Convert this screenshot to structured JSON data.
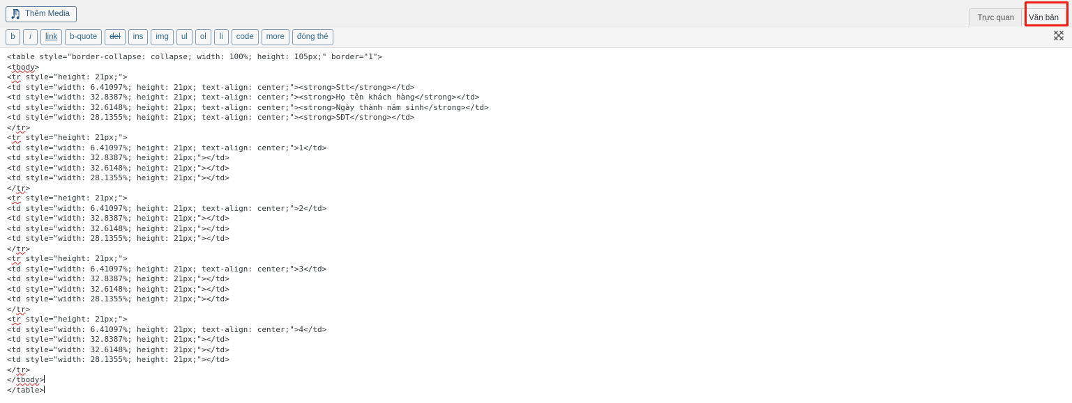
{
  "media_bar": {
    "add_media_label": "Thêm Media",
    "add_media_icon": "admin-media-icon"
  },
  "editor_tabs": {
    "visual_label": "Trực quan",
    "text_label": "Văn bản",
    "active": "Văn bản",
    "highlight_color": "#ee1b11"
  },
  "quicktags": {
    "buttons": [
      {
        "label": "b",
        "name": "quicktag-bold"
      },
      {
        "label": "i",
        "name": "quicktag-italic"
      },
      {
        "label": "link",
        "name": "quicktag-link"
      },
      {
        "label": "b-quote",
        "name": "quicktag-blockquote"
      },
      {
        "label": "del",
        "name": "quicktag-del"
      },
      {
        "label": "ins",
        "name": "quicktag-ins"
      },
      {
        "label": "img",
        "name": "quicktag-img"
      },
      {
        "label": "ul",
        "name": "quicktag-ul"
      },
      {
        "label": "ol",
        "name": "quicktag-ol"
      },
      {
        "label": "li",
        "name": "quicktag-li"
      },
      {
        "label": "code",
        "name": "quicktag-code"
      },
      {
        "label": "more",
        "name": "quicktag-more"
      },
      {
        "label": "đóng thẻ",
        "name": "quicktag-close-tags"
      }
    ],
    "fullscreen_icon": "fullscreen-icon"
  },
  "code_editor": {
    "lines": [
      "<table style=\"border-collapse: collapse; width: 100%; height: 105px;\" border=\"1\">",
      "<tbody>",
      "<tr style=\"height: 21px;\">",
      "<td style=\"width: 6.41097%; height: 21px; text-align: center;\"><strong>Stt</strong></td>",
      "<td style=\"width: 32.8387%; height: 21px; text-align: center;\"><strong>Họ tên khách hàng</strong></td>",
      "<td style=\"width: 32.6148%; height: 21px; text-align: center;\"><strong>Ngày thành năm sinh</strong></td>",
      "<td style=\"width: 28.1355%; height: 21px; text-align: center;\"><strong>SĐT</strong></td>",
      "</tr>",
      "<tr style=\"height: 21px;\">",
      "<td style=\"width: 6.41097%; height: 21px; text-align: center;\">1</td>",
      "<td style=\"width: 32.8387%; height: 21px;\"></td>",
      "<td style=\"width: 32.6148%; height: 21px;\"></td>",
      "<td style=\"width: 28.1355%; height: 21px;\"></td>",
      "</tr>",
      "<tr style=\"height: 21px;\">",
      "<td style=\"width: 6.41097%; height: 21px; text-align: center;\">2</td>",
      "<td style=\"width: 32.8387%; height: 21px;\"></td>",
      "<td style=\"width: 32.6148%; height: 21px;\"></td>",
      "<td style=\"width: 28.1355%; height: 21px;\"></td>",
      "</tr>",
      "<tr style=\"height: 21px;\">",
      "<td style=\"width: 6.41097%; height: 21px; text-align: center;\">3</td>",
      "<td style=\"width: 32.8387%; height: 21px;\"></td>",
      "<td style=\"width: 32.6148%; height: 21px;\"></td>",
      "<td style=\"width: 28.1355%; height: 21px;\"></td>",
      "</tr>",
      "<tr style=\"height: 21px;\">",
      "<td style=\"width: 6.41097%; height: 21px; text-align: center;\">4</td>",
      "<td style=\"width: 32.8387%; height: 21px;\"></td>",
      "<td style=\"width: 32.6148%; height: 21px;\"></td>",
      "<td style=\"width: 28.1355%; height: 21px;\"></td>",
      "</tr>",
      "</tbody>",
      "</table>"
    ],
    "spellcheck_words": [
      "tbody",
      "tr",
      "Stt",
      "SĐT"
    ],
    "caret_after_line_index": 33
  }
}
